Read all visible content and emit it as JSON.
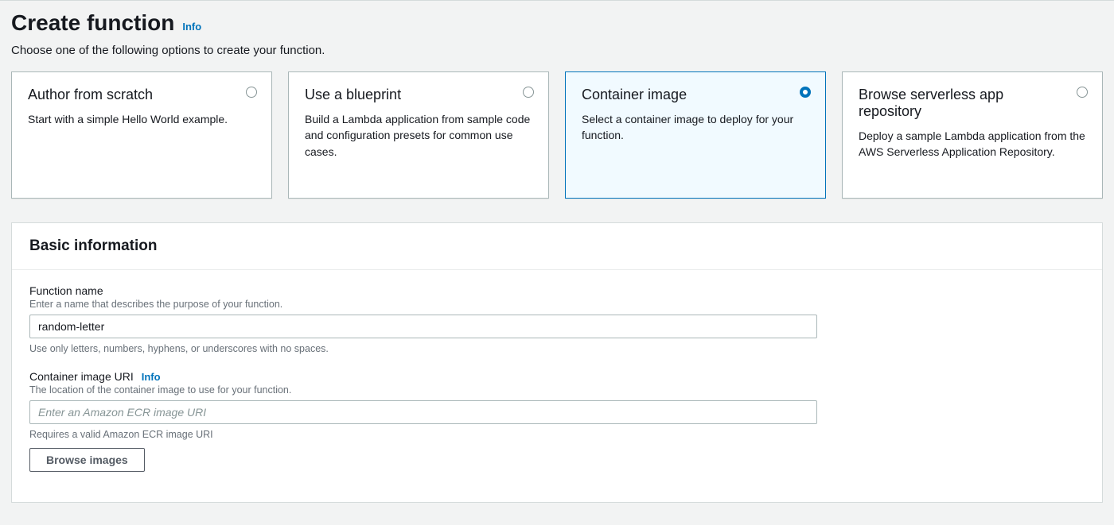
{
  "header": {
    "title": "Create function",
    "info": "Info",
    "subtitle": "Choose one of the following options to create your function."
  },
  "options": [
    {
      "title": "Author from scratch",
      "desc": "Start with a simple Hello World example.",
      "selected": false
    },
    {
      "title": "Use a blueprint",
      "desc": "Build a Lambda application from sample code and configuration presets for common use cases.",
      "selected": false
    },
    {
      "title": "Container image",
      "desc": "Select a container image to deploy for your function.",
      "selected": true
    },
    {
      "title": "Browse serverless app repository",
      "desc": "Deploy a sample Lambda application from the AWS Serverless Application Repository.",
      "selected": false
    }
  ],
  "basic": {
    "panel_title": "Basic information",
    "function_name": {
      "label": "Function name",
      "help": "Enter a name that describes the purpose of your function.",
      "value": "random-letter",
      "hint": "Use only letters, numbers, hyphens, or underscores with no spaces."
    },
    "container_uri": {
      "label": "Container image URI",
      "info": "Info",
      "help": "The location of the container image to use for your function.",
      "placeholder": "Enter an Amazon ECR image URI",
      "value": "",
      "hint": "Requires a valid Amazon ECR image URI",
      "browse_button": "Browse images"
    }
  }
}
